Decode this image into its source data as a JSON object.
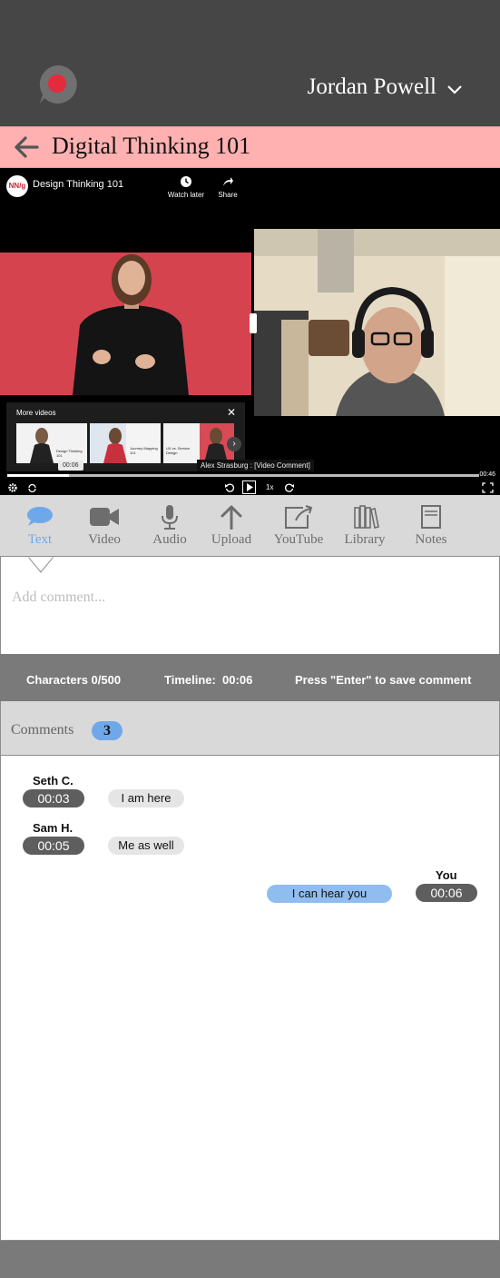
{
  "header": {
    "user_name": "Jordan Powell"
  },
  "course": {
    "title": "Digital Thinking 101"
  },
  "video": {
    "title": "Design Thinking 101",
    "channel_logo": "NN/g",
    "watch_later": "Watch later",
    "share": "Share",
    "more_videos": "More videos",
    "thumbnails": [
      "Design Thinking 101",
      "Journey Mapping 101",
      "UX vs. Service Design"
    ],
    "caption": "Alex Strasburg : [Video Comment]",
    "current_time": "00:06",
    "duration": "00:46",
    "speed": "1x",
    "progress_fraction": 0.13
  },
  "toolbar": {
    "items": [
      {
        "label": "Text",
        "icon": "speech-bubble-icon"
      },
      {
        "label": "Video",
        "icon": "video-camera-icon"
      },
      {
        "label": "Audio",
        "icon": "microphone-icon"
      },
      {
        "label": "Upload",
        "icon": "upload-arrow-icon"
      },
      {
        "label": "YouTube",
        "icon": "share-box-icon"
      },
      {
        "label": "Library",
        "icon": "books-icon"
      },
      {
        "label": "Notes",
        "icon": "notepad-icon"
      }
    ],
    "active": "Text"
  },
  "comment_box": {
    "placeholder": "Add comment..."
  },
  "status": {
    "characters": "Characters 0/500",
    "timeline": "Timeline:  00:06",
    "hint": "Press \"Enter\" to save comment"
  },
  "comments": {
    "label": "Comments",
    "count": "3",
    "items": [
      {
        "author": "Seth C.",
        "time": "00:03",
        "text": "I am here"
      },
      {
        "author": "Sam H.",
        "time": "00:05",
        "text": "Me as well"
      },
      {
        "author": "You",
        "time": "00:06",
        "text": "I can hear you"
      }
    ]
  },
  "colors": {
    "header_bg": "#464646",
    "course_bar": "#ffb0b0",
    "accent": "#6fa8ea",
    "status_bar": "#7a7a7a"
  }
}
